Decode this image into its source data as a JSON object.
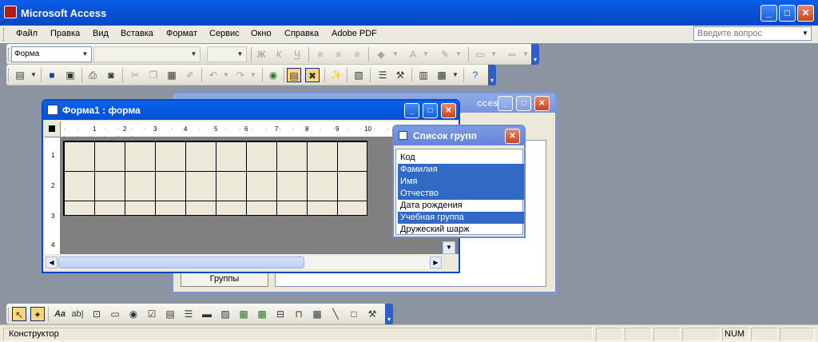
{
  "app": {
    "title": "Microsoft Access"
  },
  "menu": {
    "items": [
      "Файл",
      "Правка",
      "Вид",
      "Вставка",
      "Формат",
      "Сервис",
      "Окно",
      "Справка",
      "Adobe PDF"
    ]
  },
  "help_box": {
    "placeholder": "Введите вопрос"
  },
  "formatting_toolbar": {
    "object_combo": "Форма"
  },
  "form_window": {
    "title": "Форма1 : форма",
    "ruler_numbers": [
      "1",
      "2",
      "3",
      "4",
      "5",
      "6",
      "7",
      "8",
      "9",
      "10"
    ],
    "v_ruler_numbers": [
      "1",
      "2",
      "3",
      "4"
    ]
  },
  "back_window": {
    "title_fragment": "cces...",
    "button_label": "Группы"
  },
  "field_list": {
    "title": "Список групп",
    "items": [
      {
        "label": "Код",
        "selected": false
      },
      {
        "label": "Фамилия",
        "selected": true
      },
      {
        "label": "Имя",
        "selected": true
      },
      {
        "label": "Отчество",
        "selected": true
      },
      {
        "label": "Дата рождения",
        "selected": false
      },
      {
        "label": "Учебная группа",
        "selected": true
      },
      {
        "label": "Дружеский шарж",
        "selected": false
      }
    ]
  },
  "toolbox": {
    "icons": [
      "select-objects-icon",
      "control-wizards-icon",
      "label-icon",
      "text-box-icon",
      "option-group-icon",
      "toggle-button-icon",
      "option-button-icon",
      "check-box-icon",
      "combo-box-icon",
      "list-box-icon",
      "command-button-icon",
      "image-icon",
      "unbound-object-icon",
      "bound-object-icon",
      "page-break-icon",
      "tab-control-icon",
      "subform-icon",
      "line-icon",
      "rectangle-icon",
      "more-controls-icon"
    ]
  },
  "status": {
    "mode": "Конструктор",
    "num": "NUM"
  },
  "colors": {
    "titlebar": "#0a5ee8",
    "selection": "#316ac5",
    "mdi_background": "#8c93a1"
  }
}
